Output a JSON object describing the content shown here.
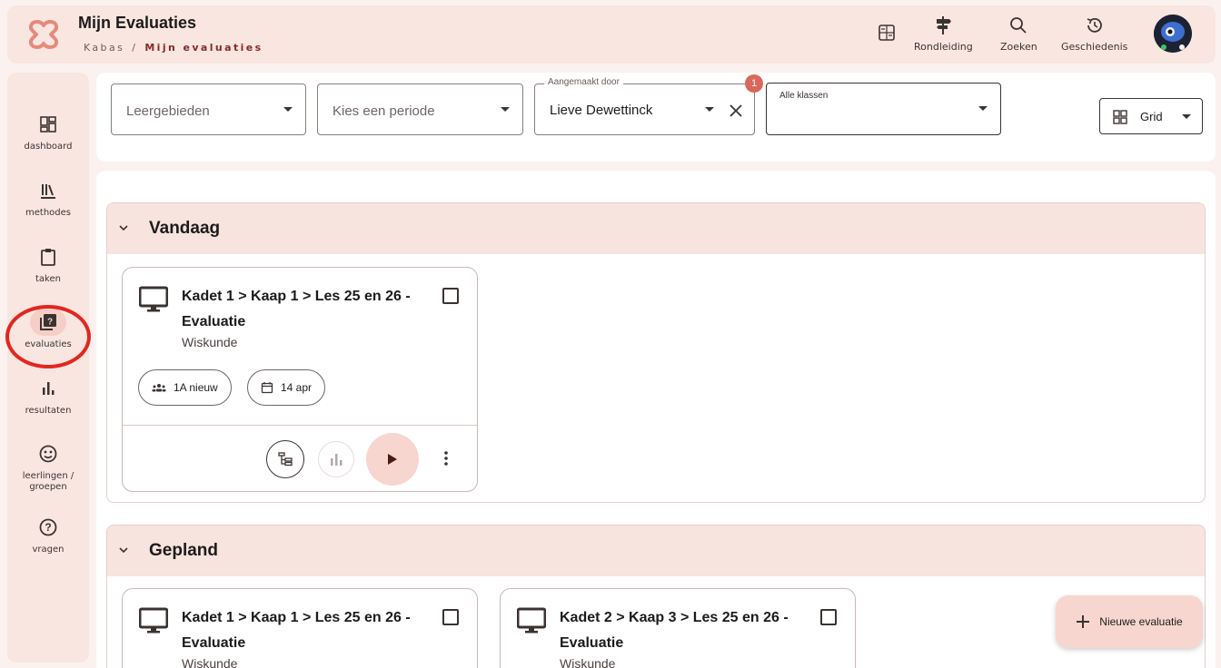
{
  "header": {
    "title": "Mijn Evaluaties",
    "breadcrumb": [
      "Kabas",
      "Mijn evaluaties"
    ],
    "buttons": [
      {
        "label": "",
        "icon": "calculator-icon"
      },
      {
        "label": "Rondleiding",
        "icon": "signpost-icon"
      },
      {
        "label": "Zoeken",
        "icon": "search-icon"
      },
      {
        "label": "Geschiedenis",
        "icon": "history-icon"
      }
    ]
  },
  "sidebar": {
    "items": [
      {
        "label": "dashboard",
        "icon": "dashboard-icon"
      },
      {
        "label": "methodes",
        "icon": "library-icon"
      },
      {
        "label": "taken",
        "icon": "clipboard-icon"
      },
      {
        "label": "evaluaties",
        "icon": "quiz-icon",
        "active": true
      },
      {
        "label": "resultaten",
        "icon": "bar-chart-icon"
      },
      {
        "label": "leerlingen /\ngroepen",
        "icon": "face-icon"
      },
      {
        "label": "vragen",
        "icon": "help-icon"
      }
    ]
  },
  "filters": {
    "leergebieden": {
      "placeholder": "Leergebieden"
    },
    "periode": {
      "placeholder": "Kies een periode"
    },
    "aangemaakt": {
      "legend": "Aangemaakt door",
      "value": "Lieve Dewettinck",
      "badge": "1"
    },
    "klassen": {
      "label": "Alle klassen"
    },
    "view": {
      "value": "Grid"
    }
  },
  "sections": [
    {
      "title": "Vandaag",
      "cards": [
        {
          "title": "Kadet 1 > Kaap 1 > Les 25 en 26 - Evaluatie",
          "subject": "Wiskunde",
          "group": "1A nieuw",
          "date": "14 apr"
        }
      ]
    },
    {
      "title": "Gepland",
      "cards": [
        {
          "title": "Kadet 1 > Kaap 1 > Les 25 en 26 - Evaluatie",
          "subject": "Wiskunde"
        },
        {
          "title": "Kadet 2 > Kaap 3 > Les 25 en 26 - Evaluatie",
          "subject": "Wiskunde"
        }
      ]
    }
  ],
  "fab": {
    "label": "Nieuwe evaluatie"
  },
  "colors": {
    "accent": "#f7d6cf",
    "brand": "#e07a6a",
    "annotation": "#e3261f"
  }
}
